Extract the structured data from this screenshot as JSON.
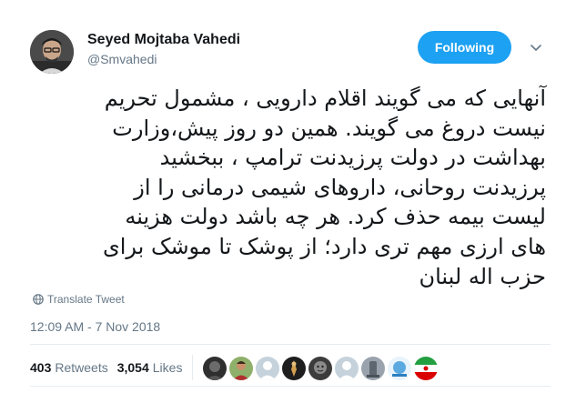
{
  "author": {
    "name": "Seyed Mojtaba Vahedi",
    "handle": "@Smvahedi"
  },
  "follow_button": {
    "label": "Following"
  },
  "tweet": {
    "lines": [
      "آنهایی که می گویند اقلام دارویی ، مشمول تحریم",
      "نیست دروغ می گویند. همین دو روز پیش،وزارت",
      "بهداشت در دولت پرزیدنت ترامپ ، ببخشید",
      "پرزیدنت روحانی، داروهای شیمی درمانی را از",
      "لیست بیمه حذف کرد. هر چه باشد دولت هزینه",
      "های ارزی مهم تری دارد؛ از پوشک تا موشک برای",
      "حزب اله لبنان"
    ],
    "translate_label": "Translate Tweet",
    "timestamp": "12:09 AM - 7 Nov 2018"
  },
  "stats": {
    "retweets_count": "403",
    "retweets_label": "Retweets",
    "likes_count": "3,054",
    "likes_label": "Likes"
  },
  "colors": {
    "accent": "#1da1f2",
    "text": "#14171a",
    "secondary": "#657786",
    "divider": "#e6ecf0"
  },
  "likers": [
    {
      "icon": "user-avatar-dark"
    },
    {
      "icon": "user-avatar-portrait"
    },
    {
      "icon": "default-profile-icon"
    },
    {
      "icon": "user-avatar-dark-figure"
    },
    {
      "icon": "user-avatar-face"
    },
    {
      "icon": "default-profile-icon"
    },
    {
      "icon": "user-avatar-statue"
    },
    {
      "icon": "user-avatar-blue-logo"
    },
    {
      "icon": "user-avatar-flag"
    }
  ]
}
